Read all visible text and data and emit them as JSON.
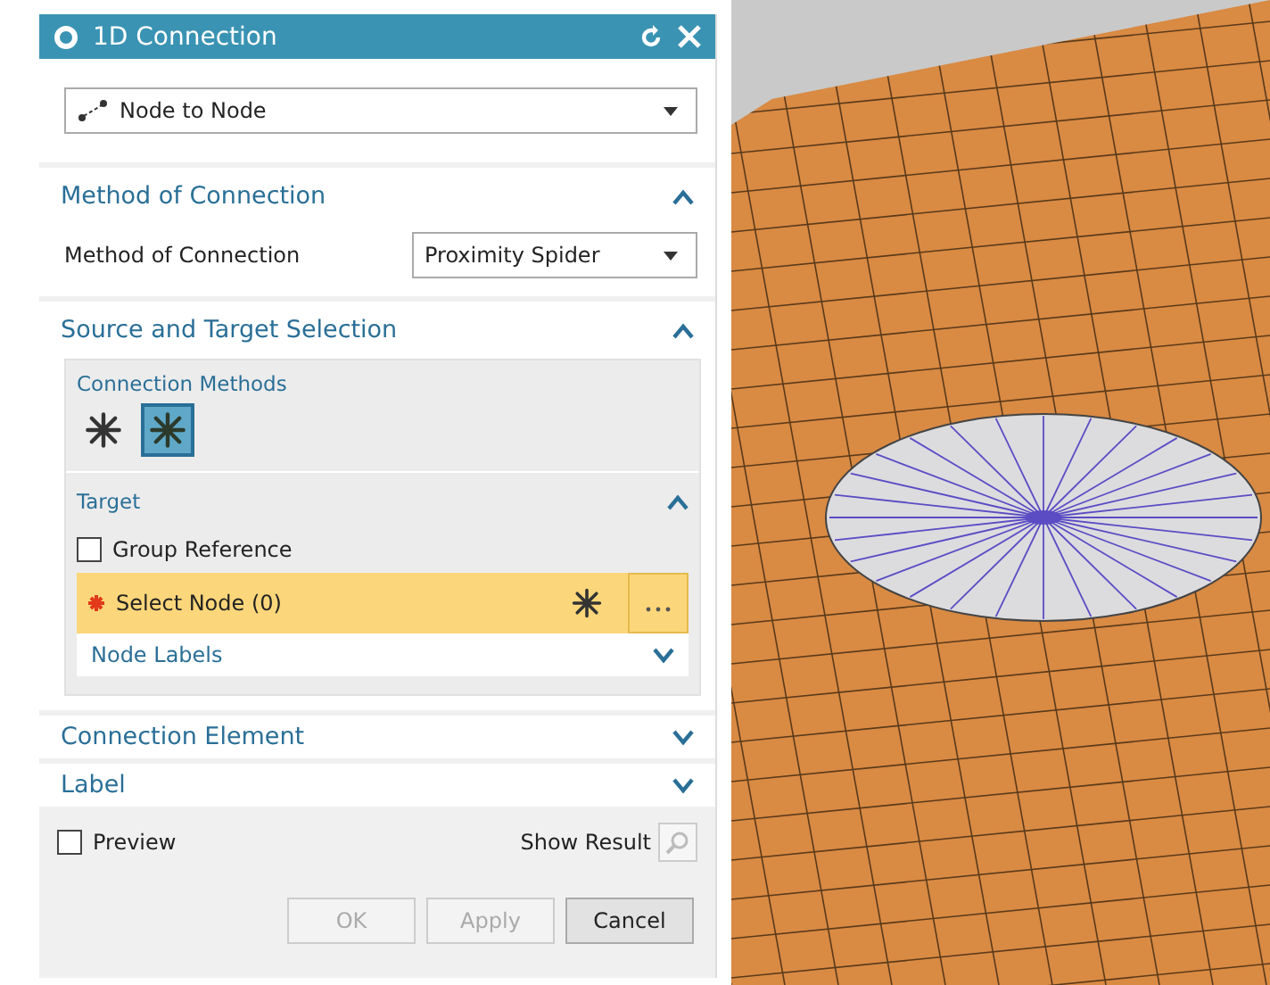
{
  "window": {
    "title": "1D Connection"
  },
  "type_dropdown": {
    "value": "Node to Node"
  },
  "method_section": {
    "title": "Method of Connection",
    "expanded": true,
    "label": "Method of Connection",
    "value": "Proximity Spider"
  },
  "selection_section": {
    "title": "Source and Target Selection",
    "expanded": true,
    "methods_title": "Connection Methods",
    "methods": [
      {
        "kind": "single",
        "selected": false
      },
      {
        "kind": "spider",
        "selected": true
      }
    ],
    "target": {
      "title": "Target",
      "expanded": true,
      "group_reference": {
        "label": "Group Reference",
        "checked": false
      },
      "select_node": {
        "label": "Select Node (0)",
        "required": true,
        "active": true
      },
      "node_labels": {
        "title": "Node Labels",
        "expanded": false
      }
    }
  },
  "collapsed_sections": [
    {
      "title": "Connection Element",
      "expanded": false
    },
    {
      "title": "Label",
      "expanded": false
    }
  ],
  "preview": {
    "label": "Preview",
    "checked": false,
    "show_result": "Show Result"
  },
  "buttons": [
    {
      "label": "OK",
      "disabled": true
    },
    {
      "label": "Apply",
      "disabled": true
    },
    {
      "label": "Cancel",
      "disabled": false
    }
  ]
}
